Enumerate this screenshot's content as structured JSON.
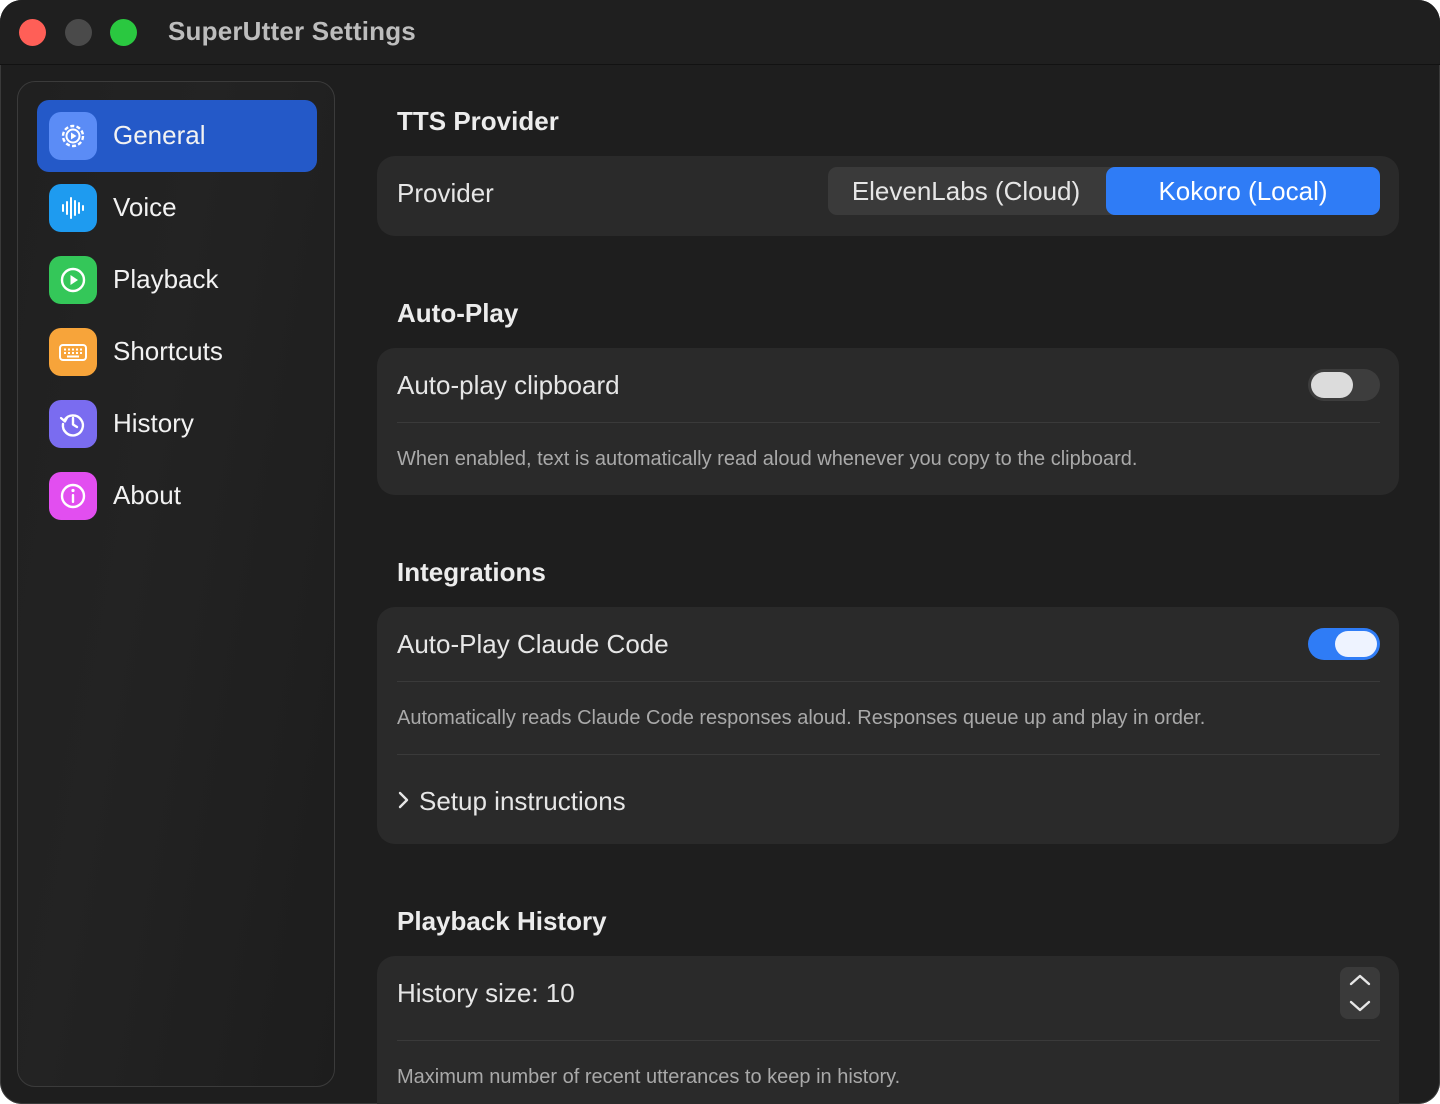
{
  "window": {
    "title": "SuperUtter Settings"
  },
  "sidebar": {
    "items": [
      {
        "label": "General",
        "icon": "gear-icon",
        "color": "#5b8cf6",
        "active": true
      },
      {
        "label": "Voice",
        "icon": "waveform-icon",
        "color": "#1e9bf0",
        "active": false
      },
      {
        "label": "Playback",
        "icon": "play-circle-icon",
        "color": "#34c759",
        "active": false
      },
      {
        "label": "Shortcuts",
        "icon": "keyboard-icon",
        "color": "#f7a43a",
        "active": false
      },
      {
        "label": "History",
        "icon": "history-icon",
        "color": "#7a6cf0",
        "active": false
      },
      {
        "label": "About",
        "icon": "info-icon",
        "color": "#e24ef0",
        "active": false
      }
    ]
  },
  "tts": {
    "section_title": "TTS Provider",
    "provider_label": "Provider",
    "options": [
      "ElevenLabs (Cloud)",
      "Kokoro (Local)"
    ],
    "selected": "Kokoro (Local)"
  },
  "autoplay": {
    "section_title": "Auto-Play",
    "toggle_label": "Auto-play clipboard",
    "enabled": false,
    "description": "When enabled, text is automatically read aloud whenever you copy to the clipboard."
  },
  "integrations": {
    "section_title": "Integrations",
    "toggle_label": "Auto-Play Claude Code",
    "enabled": true,
    "description": "Automatically reads Claude Code responses aloud. Responses queue up and play in order.",
    "setup_label": "Setup instructions"
  },
  "history": {
    "section_title": "Playback History",
    "size_label": "History size: 10",
    "size_value": 10,
    "description": "Maximum number of recent utterances to keep in history."
  },
  "colors": {
    "accent": "#2f7cf6",
    "sidebar_selected": "#2459c8",
    "window_bg": "#1e1e1e",
    "card_bg": "#2a2a2a"
  }
}
